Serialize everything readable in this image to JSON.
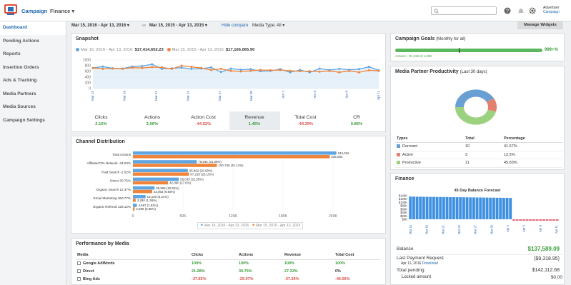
{
  "header": {
    "brand": "Campaign",
    "section": "Finance ▾",
    "user_role": "Advertiser",
    "user_campaign": "Campaign"
  },
  "sidebar": {
    "items": [
      {
        "label": "Dashboard",
        "active": true
      },
      {
        "label": "Pending Actions"
      },
      {
        "label": "Reports"
      },
      {
        "label": "Insertion Orders"
      },
      {
        "label": "Ads & Tracking"
      },
      {
        "label": "Media Partners"
      },
      {
        "label": "Media Sources"
      },
      {
        "label": "Campaign Settings"
      }
    ]
  },
  "filters": {
    "date1": "Mar 15, 2016 - Apr 13, 2016 ▾",
    "vs": "vs",
    "date2": "Mar 15, 2015 - Apr 13, 2015 ▾",
    "hide": "Hide compare",
    "media": "Media Type: All ▾",
    "manage": "Manage Widgets"
  },
  "snapshot": {
    "title": "Snapshot",
    "legend1": "Mar 15, 2016 - Apr 13, 2016:",
    "value1": "$17,414,652.23",
    "legend2": "Mar 15, 2015 - Apr 13, 2015:",
    "value2": "$17,166,065.90",
    "kpis": [
      {
        "label": "Clicks",
        "value": "2.15%",
        "trend": "pos"
      },
      {
        "label": "Actions",
        "value": "2.06%",
        "trend": "pos"
      },
      {
        "label": "Action Cost",
        "value": "-44.52%",
        "trend": "neg"
      },
      {
        "label": "Revenue",
        "value": "1.45%",
        "trend": "pos",
        "selected": true
      },
      {
        "label": "Total Cost",
        "value": "-44.39%",
        "trend": "neg"
      },
      {
        "label": "CR",
        "value": "0.86%",
        "trend": "pos"
      }
    ]
  },
  "channel": {
    "title": "Channel Distribution",
    "legend1": "Mar 15, 2016 - Apr 13, 2016",
    "legend2": "Mar 15, 2015 - Apr 13, 2015"
  },
  "performance": {
    "title": "Performance by Media",
    "headers": [
      "Media",
      "Clicks",
      "Actions",
      "Revenue",
      "Total Cost"
    ],
    "rows": [
      {
        "media": "Google AdWords",
        "clicks": "100%",
        "actions": "100%",
        "revenue": "100%",
        "cost": "100%",
        "c": "pos",
        "a": "pos",
        "r": "pos",
        "t": "pos"
      },
      {
        "media": "Direct",
        "clicks": "21.28%",
        "actions": "30.75%",
        "revenue": "27.33%",
        "cost": "0%",
        "c": "pos",
        "a": "pos",
        "r": "pos",
        "t": "zero"
      },
      {
        "media": "Bing Ads",
        "clicks": "-37.83%",
        "actions": "-29.97%",
        "revenue": "-37.29%",
        "cost": "-46.06%",
        "c": "neg",
        "a": "neg",
        "r": "neg",
        "t": "neg"
      }
    ]
  },
  "goals": {
    "title": "Campaign Goals",
    "subtitle": "(Monthly for all)",
    "pct": "999+%",
    "actions": "Actions – 81,553 of 1,000",
    "fill": 1.0
  },
  "partner": {
    "title": "Media Partner Productivity",
    "subtitle": "(Last 30 days)",
    "headers": [
      "Types",
      "Total",
      "Percentage"
    ],
    "rows": [
      {
        "type": "Dormant",
        "total": "10",
        "pct": "41.67%",
        "color": "#6a9fd4"
      },
      {
        "type": "Active",
        "total": "3",
        "pct": "12.5%",
        "color": "#e3816f"
      },
      {
        "type": "Productive",
        "total": "11",
        "pct": "45.83%",
        "color": "#9cd17f"
      }
    ]
  },
  "finance": {
    "title": "Finance",
    "chart_title": "45 Day Balance Forecast",
    "balance_label": "Balance",
    "balance": "$137,589.09",
    "last_payment_label": "Last Payment Request",
    "last_payment": "($9,318.95)",
    "last_payment_date": "Apr 11, 2016",
    "download": "Download",
    "total_pending_label": "Total pending",
    "total_pending": "$142,112.68",
    "locked_label": "Locked amount",
    "locked": "$0.00"
  },
  "chart_data": [
    {
      "type": "line",
      "x": [
        "Mar 15",
        "Mar 18",
        "Mar 21",
        "Mar 24",
        "Mar 27",
        "Mar 30",
        "Apr 2",
        "Apr 5",
        "Apr 8",
        "Apr 11"
      ],
      "ylim": [
        0,
        1000
      ],
      "yticks": [
        "0",
        "200",
        "400",
        "600",
        "800",
        "1000"
      ],
      "series": [
        {
          "name": "Mar 15, 2016 - Apr 13, 2016",
          "color": "#5ea5e2",
          "values": [
            720,
            770,
            710,
            700,
            770,
            790,
            850,
            690,
            710,
            730,
            690,
            700,
            740,
            580,
            700,
            660,
            680,
            610,
            620,
            680,
            570,
            650,
            570,
            700,
            650,
            690,
            660,
            680,
            760,
            640
          ]
        },
        {
          "name": "Mar 15, 2015 - Apr 13, 2015",
          "color": "#f0843a",
          "values": [
            720,
            690,
            700,
            690,
            730,
            720,
            750,
            740,
            690,
            800,
            760,
            720,
            650,
            690,
            620,
            600,
            620,
            650,
            640,
            650,
            620,
            610,
            610,
            590,
            620,
            570,
            620,
            570,
            640,
            620
          ]
        }
      ]
    },
    {
      "type": "bar",
      "categories": [
        "Total Actions",
        "Affiliate/CPA Network -24.03%",
        "Paid Search -2.02%",
        "Direct 30.75%",
        "Organic Search 12.37%",
        "Email Marketing 360.77%",
        "Organic Referral 128.12%"
      ],
      "xlim": [
        0,
        240000
      ],
      "xticks": [
        "0",
        "60K",
        "120K",
        "180K",
        "240K"
      ],
      "series": [
        {
          "name": "Mar 15, 2016 - Apr 13, 2016",
          "color": "#5ea5e2",
          "values": [
            244016,
            76534,
            65862,
            55033,
            25906,
            15150,
            4697
          ],
          "labels": [
            "244,016",
            "76,534 (31.36%)",
            "65,862 (26.99%)",
            "55,033 (22.55%)",
            "25,906 (10.62%)",
            "15,150 (6.21%)",
            "4,697 (1.92%)"
          ]
        },
        {
          "name": "Mar 15, 2015 - Apr 13, 2015",
          "color": "#f0843a",
          "values": [
            236082,
            100746,
            67218,
            42090,
            23054,
            3280,
            2059
          ],
          "labels": [
            "236,082",
            "100,746 (42.14%)",
            "67,218 (28.15%)",
            "42,090 (17.6%)",
            "23,054 (9.65%)",
            "3,280 (1.38%)",
            "2,059 (0.86%)"
          ]
        }
      ]
    },
    {
      "type": "pie",
      "categories": [
        "Dormant",
        "Active",
        "Productive"
      ],
      "values": [
        41.67,
        12.5,
        45.83
      ],
      "colors": [
        "#6a9fd4",
        "#e3816f",
        "#9cd17f"
      ]
    },
    {
      "type": "bar",
      "title": "45 Day Balance Forecast",
      "yticks": [
        "$0K",
        "$20K",
        "$40K",
        "$60K",
        "$80K",
        "$100K",
        "$120K",
        "$140K"
      ],
      "ylim": [
        0,
        140000
      ],
      "values": [
        135000,
        135000,
        134000,
        134000,
        133500,
        133500,
        133000,
        133000,
        132500,
        132500,
        132000,
        132000,
        131500,
        131500,
        131000,
        131000,
        130500,
        130500,
        130000,
        130000,
        129500,
        129500,
        129000,
        129000,
        128500,
        128500,
        128000,
        128000,
        127500,
        127500,
        127000,
        -9000,
        -9000,
        -9000,
        -9000,
        -9000,
        -9000,
        -9000,
        -9000,
        -9000,
        -9000,
        -9000,
        -9000,
        -9000,
        -9000
      ],
      "colors": {
        "positive": "#3d8fe0",
        "negative": "#e3717d"
      },
      "x_labels": [
        "Mar 15",
        "Mar 18",
        "Mar 21",
        "Mar 24",
        "Mar 27",
        "Mar 30",
        "Apr 2",
        "Apr 5",
        "Apr 8",
        "Apr 11"
      ]
    }
  ]
}
